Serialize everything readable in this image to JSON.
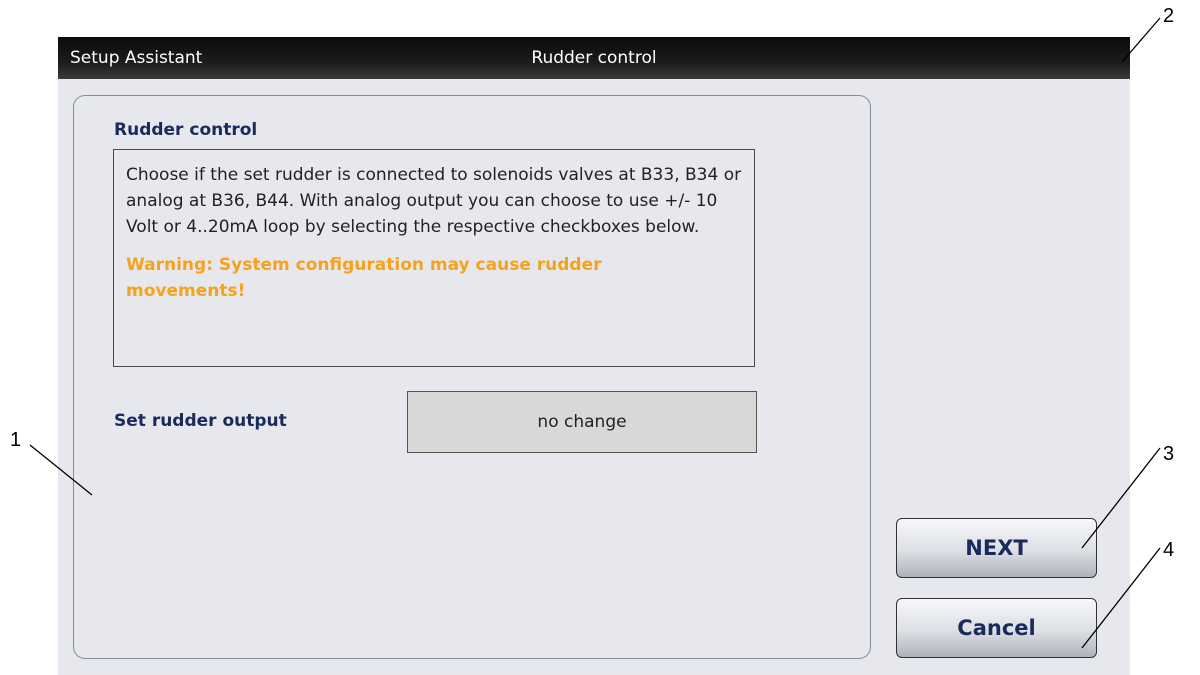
{
  "titlebar": {
    "app_name": "Setup Assistant",
    "title": "Rudder control"
  },
  "panel": {
    "heading": "Rudder control",
    "description": "Choose if the set rudder is connected to solenoids valves at B33, B34 or analog at B36, B44. With analog output you can choose to use +/- 10 Volt or 4..20mA loop by selecting the respective checkboxes below.",
    "warning": "Warning: System configuration may cause rudder movements!",
    "output_label": "Set rudder output",
    "output_value": "no change"
  },
  "buttons": {
    "next_label": "NEXT",
    "cancel_label": "Cancel"
  },
  "callouts": {
    "panel": "1",
    "titlebar": "2",
    "next": "3",
    "cancel": "4"
  },
  "colors": {
    "heading": "#1b2a5c",
    "warning": "#f7a21b",
    "background": "#e6e8ee",
    "titlebar": "#111111"
  }
}
